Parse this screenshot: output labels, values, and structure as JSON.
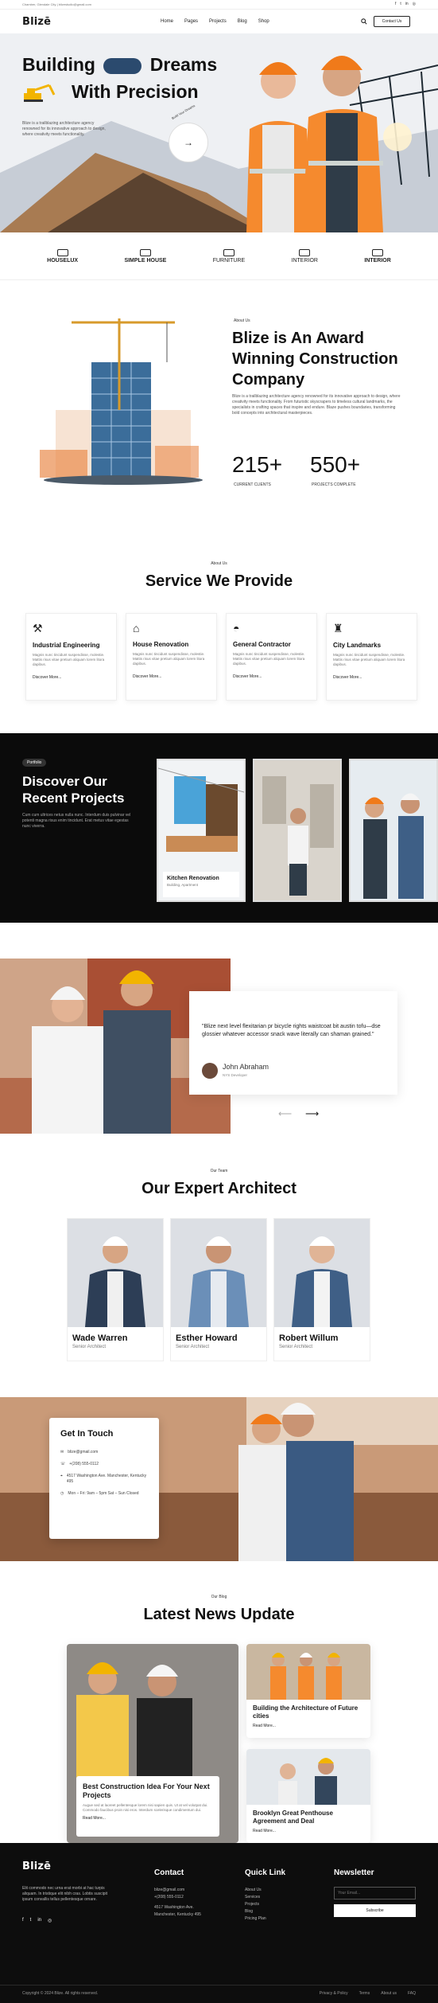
{
  "topbar": {
    "left": "Chamber, Glendale City  |  blizestudio@gmail.com"
  },
  "nav": {
    "logo": "Blizē",
    "links": [
      "Home",
      "Pages",
      "Projects",
      "Blog",
      "Shop"
    ],
    "cta": "Contact Us"
  },
  "hero": {
    "line1a": "Building",
    "line1b": "Dreams",
    "line2": "With Precision",
    "desc": "Blize is a trailblazing architecture agency renowned for its innovative approach to design, where creativity meets functionality.",
    "stamp": "Build Your Dreams"
  },
  "brands": [
    "HOUSELUX",
    "SIMPLE HOUSE",
    "FURNITURE",
    "INTERIOR",
    "INTERIOR"
  ],
  "about": {
    "tag": "About Us",
    "title_l1": "Blize is An Award",
    "title_l2": "Winning Construction",
    "title_l3": "Company",
    "desc": "Blize is a trailblazing architecture agency renowned for its innovative approach to design, where creativity meets functionality. From futuristic skyscrapers to timeless cultural landmarks, the specialists in crafting spaces that inspire and endure. Blaze pushes boundaries, transforming bold concepts into architectural masterpieces.",
    "stat1": "215+",
    "stat1_label": "CURRENT CLIENTS",
    "stat2": "550+",
    "stat2_label": "PROJECTS COMPLETE"
  },
  "services": {
    "tag": "About Us",
    "title": "Service We Provide",
    "items": [
      {
        "icon": "crane-icon",
        "title": "Industrial Engineering",
        "desc": "Magnis nunc tincidunt suspendisse, molestie. Mattis risus vitae pretium aliquam lorem litora dapibus.",
        "more": "Discover More..."
      },
      {
        "icon": "house-icon",
        "title": "House Renovation",
        "desc": "Magnis nunc tincidunt suspendisse, molestie. Mattis risus vitae pretium aliquam lorem litora dapibus.",
        "more": "Discover More..."
      },
      {
        "icon": "helmet-icon",
        "title": "General Contractor",
        "desc": "Magnis nunc tincidunt suspendisse, molestie. Mattis risus vitae pretium aliquam lorem litora dapibus.",
        "more": "Discover More..."
      },
      {
        "icon": "landmark-icon",
        "title": "City Landmarks",
        "desc": "Magnis nunc tincidunt suspendisse, molestie. Mattis risus vitae pretium aliquam lorem litora dapibus.",
        "more": "Discover More..."
      }
    ]
  },
  "projects": {
    "badge": "Portfolio",
    "title_l1": "Discover Our",
    "title_l2": "Recent Projects",
    "desc": "Cum cum ultrices netus nulla nunc. Interdum duis pulvinar vel potenti magna risus enim tincidunt. Erat metus vitae egestas nunc viverra.",
    "card_title": "Kitchen Renovation",
    "card_sub": "Building, Apartment"
  },
  "testimonial": {
    "quote": "\"Blize next level flexitarian pr bicycle rights waistcoat bit austin tofu—dse glossier whatever accessor snack wave literally can shaman grained.\"",
    "name": "John Abraham",
    "role": "NYS Developer"
  },
  "team": {
    "tag": "Our Team",
    "title": "Our Expert Architect",
    "members": [
      {
        "name": "Wade Warren",
        "role": "Senior Architect"
      },
      {
        "name": "Esther Howard",
        "role": "Senior Architect"
      },
      {
        "name": "Robert Willum",
        "role": "Senior Architect"
      }
    ]
  },
  "contact": {
    "title": "Get In Touch",
    "email": "blize@gmail.com",
    "phone": "+(208) 555-0112",
    "address": "4517 Washington Ave. Manchester, Kentucky 495",
    "hours": "Mon – Fri: 9am – 5pm Sat – Sun Closed"
  },
  "news": {
    "tag": "Our Blog",
    "title": "Latest News Update",
    "main_title": "Best Construction Idea For Your Next Projects",
    "main_desc": "Augue sed at laoreet pellentesque lorem nisi sapien quis. Ut at vel volutpat dui. Commodo faucibus proin nisi eros. Interdum scelerisque condimentum dui.",
    "main_more": "Read More...",
    "side1_title": "Building the Architecture of Future cities",
    "side1_more": "Read More...",
    "side2_title": "Brooklyn Great Penthouse Agreement and Deal",
    "side2_more": "Read More..."
  },
  "footer": {
    "logo": "Blizē",
    "desc": "Elit commodo nec urna erat morbi at hac turpis aliquam. In tristique elit nibh cras. Lobtis suscipit ipsum convallis tellus pellentesque ornare.",
    "contact_h": "Contact",
    "contact_lines": [
      "blize@gmail.com",
      "+(208) 555-0112",
      "4517 Washington Ave.",
      "Manchester, Kentucky 495"
    ],
    "quick_h": "Quick Link",
    "quick_links": [
      "About Us",
      "Services",
      "Projects",
      "Blog",
      "Pricing Plan"
    ],
    "news_h": "Newsletter",
    "news_placeholder": "Your Email...",
    "news_btn": "Subscribe",
    "copyright": "Copyright © 2024 Blize. All rights reserved.",
    "bottom_links": [
      "Privacy & Policy",
      "Terms",
      "About us",
      "FAQ"
    ]
  },
  "colors": {
    "accent": "#f7931e",
    "dark": "#0b0b0b",
    "vest": "#f58a2e"
  }
}
